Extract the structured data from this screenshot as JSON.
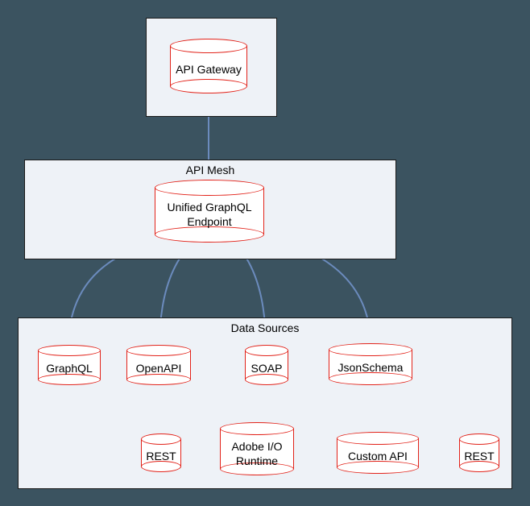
{
  "containers": {
    "apiMesh": {
      "label": "API Mesh"
    },
    "dataSources": {
      "label": "Data Sources"
    }
  },
  "nodes": {
    "apiGateway": {
      "label": "API Gateway"
    },
    "unified": {
      "label": "Unified GraphQL\nEndpoint"
    },
    "graphql": {
      "label": "GraphQL"
    },
    "openapi": {
      "label": "OpenAPI"
    },
    "soap": {
      "label": "SOAP"
    },
    "jsonschema": {
      "label": "JsonSchema"
    },
    "rest1": {
      "label": "REST"
    },
    "adobe": {
      "label": "Adobe I/O\nRuntime"
    },
    "custom": {
      "label": "Custom API"
    },
    "rest2": {
      "label": "REST"
    }
  },
  "edges": [
    [
      "apiGateway",
      "unified"
    ],
    [
      "unified",
      "graphql"
    ],
    [
      "unified",
      "openapi"
    ],
    [
      "unified",
      "soap"
    ],
    [
      "unified",
      "jsonschema"
    ],
    [
      "openapi",
      "rest1"
    ],
    [
      "jsonschema",
      "adobe"
    ],
    [
      "jsonschema",
      "custom"
    ],
    [
      "jsonschema",
      "rest2"
    ]
  ]
}
